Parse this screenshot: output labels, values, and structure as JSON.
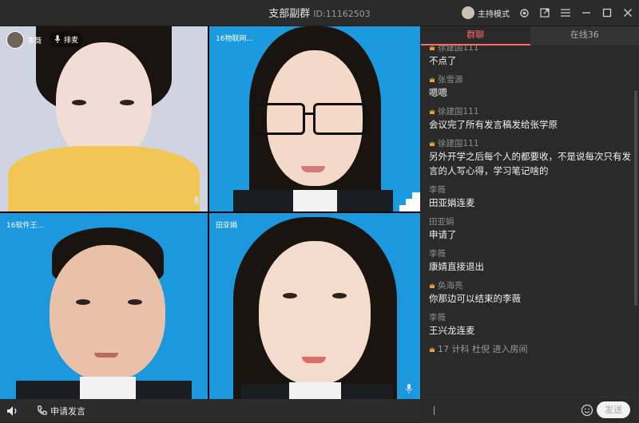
{
  "window": {
    "title": "支部副群",
    "room_id": "ID:11162503",
    "host_mode_label": "主持模式"
  },
  "video_tiles": [
    {
      "label": "李薇"
    },
    {
      "label": "16物联网..."
    },
    {
      "label": "16软件王..."
    },
    {
      "label": "田亚娟"
    }
  ],
  "mic_queue_label": "排麦",
  "bottom": {
    "apply_label": "申请发言"
  },
  "tabs": [
    {
      "label": "群聊",
      "active": true
    },
    {
      "label": "在线36",
      "active": false
    }
  ],
  "messages": [
    {
      "sender": "徐建国111",
      "text": "不点了",
      "crown": true
    },
    {
      "sender": "张雪源",
      "text": "嗯嗯",
      "crown": true
    },
    {
      "sender": "徐建国111",
      "text": "会议完了所有发言稿发给张学原",
      "crown": true
    },
    {
      "sender": "徐建国111",
      "text": "另外开学之后每个人的都要收，不是说每次只有发言的人写心得，学习笔记啥的",
      "crown": true
    },
    {
      "sender": "李薇",
      "text": "田亚娟连麦",
      "crown": false
    },
    {
      "sender": "田亚娟",
      "text": "申请了",
      "crown": false
    },
    {
      "sender": "李薇",
      "text": "康婧直接退出",
      "crown": false
    },
    {
      "sender": "奂海亮",
      "text": "你那边可以结束的李薇",
      "crown": true
    },
    {
      "sender": "李薇",
      "text": "王兴龙连麦",
      "crown": false
    }
  ],
  "system_message": "17 计科 杜倪 进入房间",
  "input": {
    "value": "",
    "send_label": "发送"
  },
  "colors": {
    "accent": "#ff6b6b",
    "crown": "#f0a030"
  }
}
